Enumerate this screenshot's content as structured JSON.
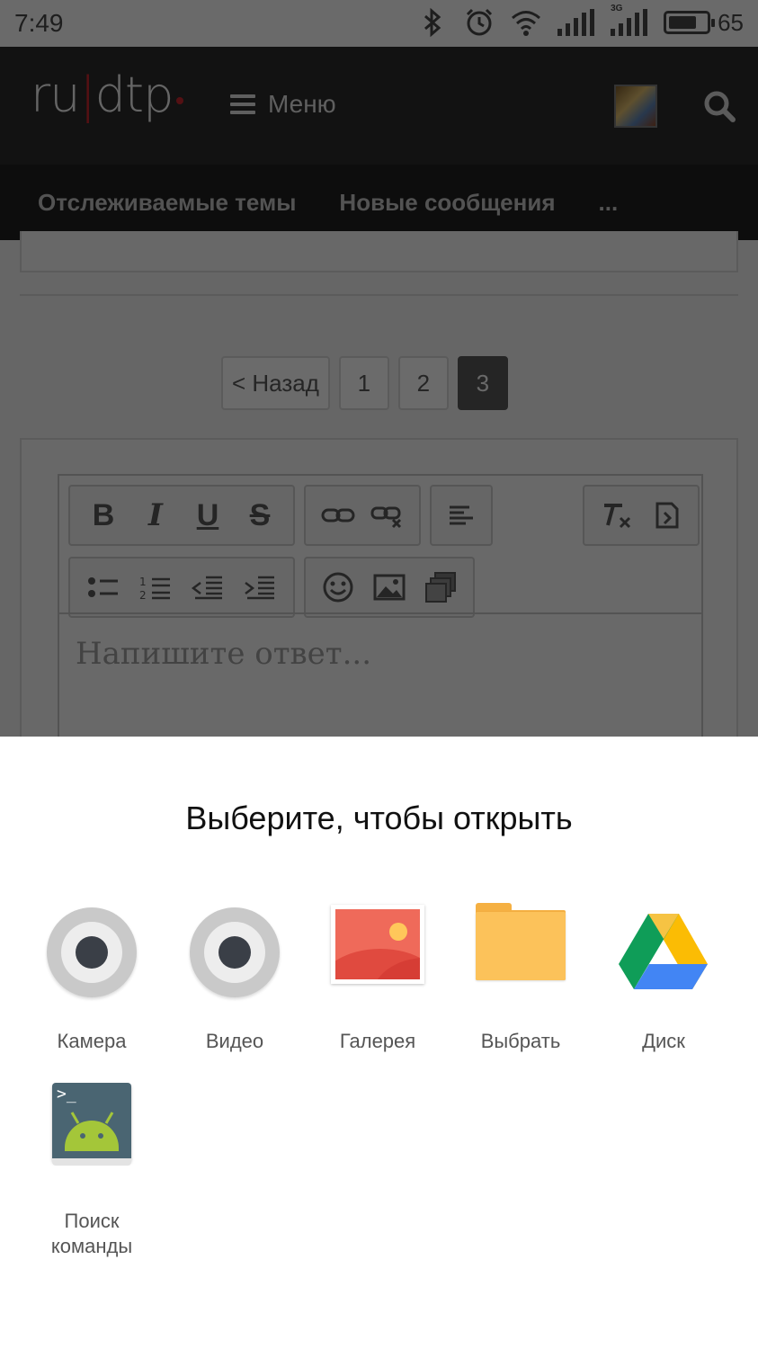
{
  "status_bar": {
    "time": "7:49",
    "battery_level": "65",
    "network_label": "3G",
    "icons": [
      "bluetooth-icon",
      "alarm-icon",
      "wifi-icon",
      "signal-icon",
      "signal-3g-icon",
      "battery-icon"
    ]
  },
  "header": {
    "logo_text_left": "ru",
    "logo_bar": "|",
    "logo_text_right": "dtp",
    "menu_label": "Меню",
    "icons": [
      "hamburger-icon",
      "avatar",
      "search-icon"
    ]
  },
  "subnav": {
    "items": [
      "Отслеживаемые темы",
      "Новые сообщения",
      "..."
    ]
  },
  "pagination": {
    "back_label": "< Назад",
    "pages": [
      "1",
      "2",
      "3"
    ],
    "active_page": "3"
  },
  "editor": {
    "toolbar_row1": [
      "bold-icon",
      "italic-icon",
      "underline-icon",
      "strikethrough-icon",
      "link-icon",
      "unlink-icon",
      "align-icon",
      "clear-format-icon",
      "source-icon"
    ],
    "toolbar_row2": [
      "bullet-list-icon",
      "numbered-list-icon",
      "outdent-icon",
      "indent-icon",
      "smiley-icon",
      "image-icon",
      "media-icon"
    ],
    "bold_glyph": "B",
    "italic_glyph": "I",
    "underline_glyph": "U",
    "strike_glyph": "S",
    "placeholder": "Напишите ответ..."
  },
  "chooser": {
    "title": "Выберите, чтобы открыть",
    "apps": [
      {
        "label": "Камера",
        "icon": "camera-icon"
      },
      {
        "label": "Видео",
        "icon": "video-camera-icon"
      },
      {
        "label": "Галерея",
        "icon": "gallery-icon"
      },
      {
        "label": "Выбрать",
        "icon": "folder-icon"
      },
      {
        "label": "Диск",
        "icon": "google-drive-icon"
      },
      {
        "label": "Поиск команды",
        "icon": "terminal-icon"
      }
    ]
  },
  "colors": {
    "header_bg": "#2b2b2b",
    "subnav_bg": "#1f1f1f",
    "logo_accent": "#c0262d",
    "dim_overlay": "rgba(0,0,0,0.56)",
    "sheet_bg": "#ffffff"
  }
}
